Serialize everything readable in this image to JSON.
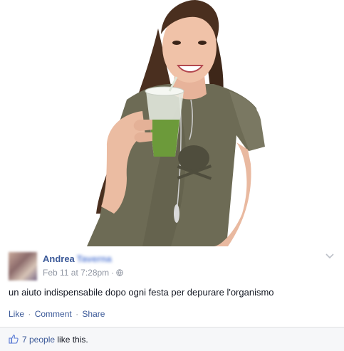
{
  "post": {
    "author_first": "Andrea",
    "author_last": "Taverna",
    "timestamp": "Feb 11 at 7:28pm",
    "separator": "·",
    "text": "un aiuto indispensabile dopo ogni festa per depurare l'organismo"
  },
  "actions": {
    "like": "Like",
    "comment": "Comment",
    "share": "Share",
    "separator": "·"
  },
  "likes": {
    "count_label": "7 people",
    "suffix": " like this."
  },
  "colors": {
    "link": "#3b5998",
    "meta": "#9197a3",
    "footer_bg": "#f6f7f9",
    "shirt": "#6d6b55"
  },
  "icons": {
    "privacy": "globe-icon",
    "menu": "chevron-down-icon",
    "likes": "thumbs-up-icon"
  }
}
